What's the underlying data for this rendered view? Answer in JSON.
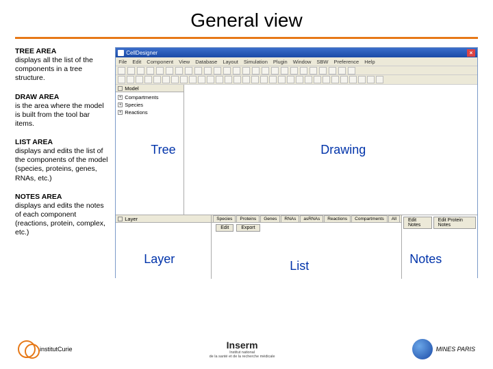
{
  "title": "General view",
  "left": {
    "tree": {
      "h": "TREE AREA",
      "t": "displays all the list of the components in a tree structure."
    },
    "draw": {
      "h": "DRAW AREA",
      "t": "is the area where the model is built from the tool bar items."
    },
    "list": {
      "h": "LIST AREA",
      "t": "displays and edits the list of the components of the model (species, proteins, genes, RNAs, etc.)"
    },
    "notes": {
      "h": "NOTES AREA",
      "t": "displays and edits the notes of each component (reactions, protein, complex, etc.)"
    }
  },
  "app": {
    "title": "CellDesigner",
    "menu": [
      "File",
      "Edit",
      "Component",
      "View",
      "Database",
      "Layout",
      "Simulation",
      "Plugin",
      "Window",
      "SBW",
      "Preference",
      "Help"
    ],
    "tree_root": "Model",
    "tree_items": [
      "Compartments",
      "Species",
      "Reactions"
    ],
    "layer_label": "Layer",
    "list_tabs": [
      "Species",
      "Proteins",
      "Genes",
      "RNAs",
      "asRNAs",
      "Reactions",
      "Compartments",
      "All"
    ],
    "list_btns": [
      "Edit",
      "Export"
    ],
    "notes_btns": [
      "Edit Notes",
      "Edit Protein Notes"
    ]
  },
  "overlays": {
    "tree": "Tree",
    "drawing": "Drawing",
    "layer": "Layer",
    "list": "List",
    "notes": "Notes"
  },
  "footer": {
    "curie": "institutCurie",
    "inserm_big": "Inserm",
    "inserm_small1": "Institut national",
    "inserm_small2": "de la santé et de la recherche médicale",
    "mines": "MINES PARIS"
  }
}
